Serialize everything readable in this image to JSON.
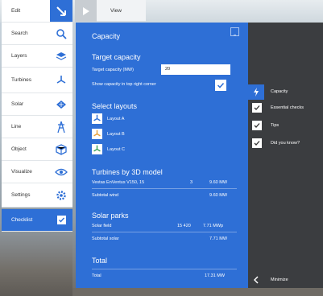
{
  "toolbar": {
    "edit": "Edit",
    "search": "Search",
    "layers": "Layers",
    "turbines": "Turbines",
    "solar": "Solar",
    "line": "Line",
    "object": "Object",
    "visualize": "Visualize",
    "settings": "Settings",
    "checklist": "Checklist"
  },
  "view_tab": {
    "label": "View"
  },
  "panel": {
    "title": "Capacity",
    "target": {
      "title": "Target capacity",
      "field_label": "Target capacity (MW)",
      "field_value": "20",
      "show_label": "Show capacity in top right corner"
    },
    "layouts": {
      "title": "Select layouts",
      "items": [
        "Layout A",
        "Layout B",
        "Layout C"
      ],
      "colors": [
        "#2e6fd6",
        "#e8a13a",
        "#3aa35a"
      ]
    },
    "turbines": {
      "title": "Turbines by 3D model",
      "row_name": "Vestas EnVentus V150, 15",
      "row_count": "3",
      "row_value": "9.60 MW",
      "subtotal_label": "Subtotal wind",
      "subtotal_value": "9.60 MW"
    },
    "solar": {
      "title": "Solar parks",
      "row_name": "Solar field",
      "row_count": "15 420",
      "row_value": "7.71 MWp",
      "subtotal_label": "Subtotal solar",
      "subtotal_value": "7.71 MW"
    },
    "total": {
      "title": "Total",
      "label": "Total",
      "value": "17.31 MW"
    }
  },
  "checklist": {
    "items": [
      "Capacity",
      "Essential checks",
      "Tips",
      "Did you know?"
    ],
    "minimize": "Minimize"
  },
  "colors": {
    "accent": "#2e6fd6",
    "dark": "#3b3d40"
  }
}
